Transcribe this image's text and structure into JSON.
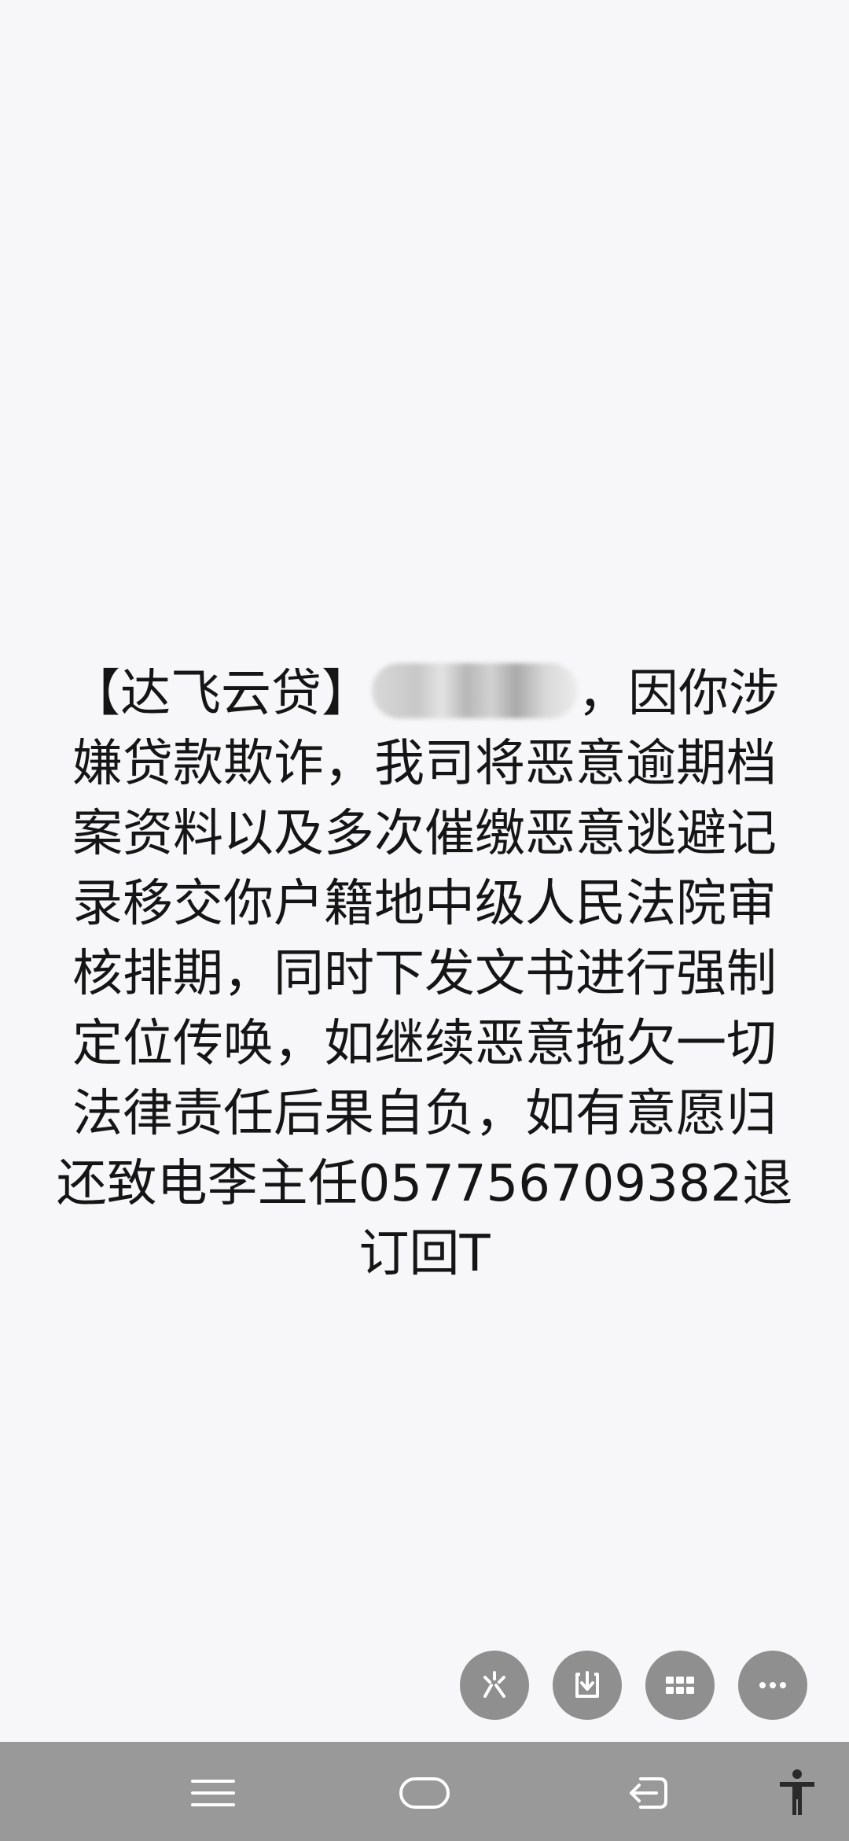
{
  "message": {
    "prefix": "【达飞云贷】",
    "body": "，因你涉嫌贷款欺诈，我司将恶意逾期档案资料以及多次催缴恶意逃避记录移交你户籍地中级人民法院审核排期，同时下发文书进行强制定位传唤，如继续恶意拖欠一切法律责任后果自负，如有意愿归还致电李主任057756709382退订回T"
  },
  "actions": [
    {
      "icon": "sparkle-icon"
    },
    {
      "icon": "download-icon"
    },
    {
      "icon": "grid-icon"
    },
    {
      "icon": "more-icon"
    }
  ],
  "navbar": {
    "items": [
      "menu-icon",
      "home-icon",
      "back-icon",
      "accessibility-icon"
    ]
  },
  "colors": {
    "background": "#f7f7f9",
    "text": "#151515",
    "action_button": "#8f8f90",
    "navbar": "#999999"
  }
}
